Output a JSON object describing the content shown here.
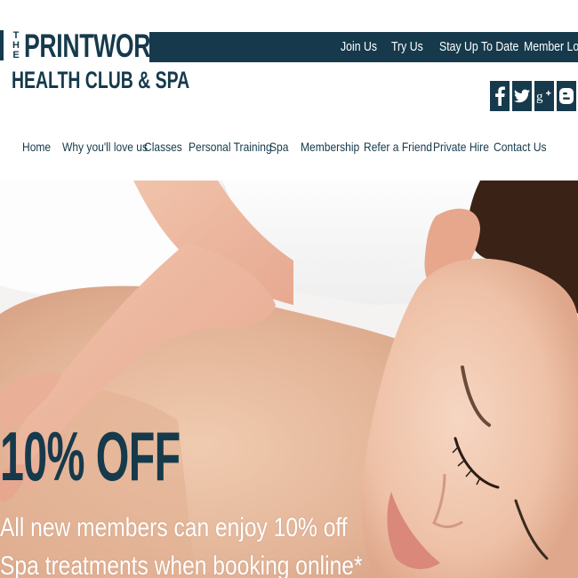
{
  "logo": {
    "the": "THE",
    "line1": "PRINTWORKS",
    "line2": "HEALTH CLUB & SPA"
  },
  "topbar": {
    "links": [
      "Join Us",
      "Try Us",
      "Stay Up To Date",
      "Member Login"
    ]
  },
  "social": {
    "icons": [
      "facebook-icon",
      "twitter-icon",
      "google-plus-icon",
      "blogger-icon"
    ]
  },
  "nav": {
    "items": [
      "Home",
      "Why you'll love us",
      "Classes",
      "Personal Training",
      "Spa",
      "Membership",
      "Refer a Friend",
      "Private Hire",
      "Contact Us"
    ]
  },
  "hero": {
    "headline": "10% OFF",
    "line1": "All new members can enjoy 10% off",
    "line2": "Spa treatments when booking online*"
  },
  "colors": {
    "brand": "#163a4c",
    "hero_text": "#ffffff",
    "background": "#ffffff"
  }
}
